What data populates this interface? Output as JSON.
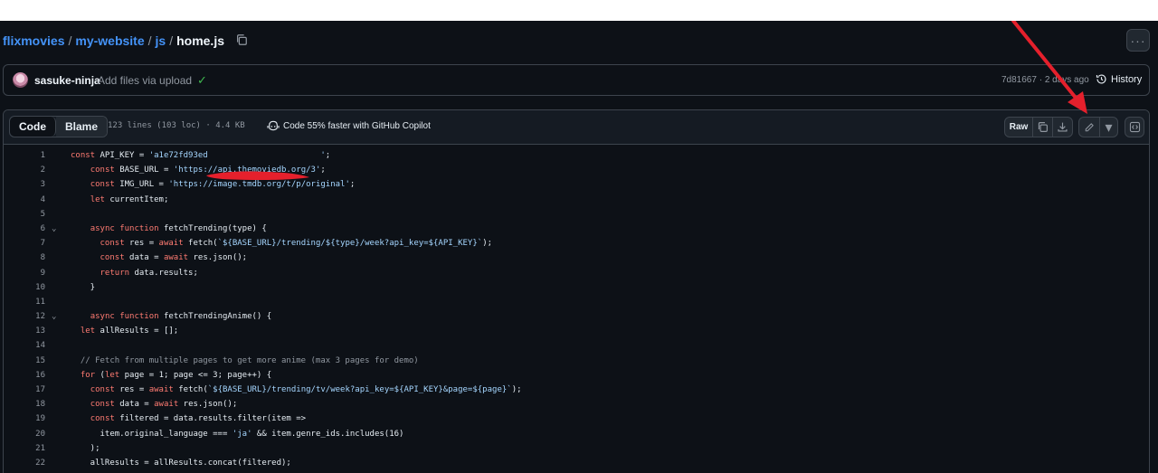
{
  "breadcrumb": {
    "owner": "flixmovies",
    "repo": "my-website",
    "dir": "js",
    "file": "home.js",
    "sep": "/"
  },
  "header": {
    "more_icon": "kebab-horizontal-icon",
    "more_label": "···"
  },
  "commit": {
    "author": "sasuke-ninja",
    "message": "Add files via upload",
    "status": "✓",
    "meta": "7d81667 · 2 days ago",
    "history_label": "History"
  },
  "file_header": {
    "tab_code": "Code",
    "tab_blame": "Blame",
    "info": "123 lines (103 loc) · 4.4 KB",
    "copilot": "Code 55% faster with GitHub Copilot",
    "raw_label": "Raw",
    "caret": "▾"
  },
  "colors": {
    "accent_link": "#4493f8",
    "success": "#3fb950",
    "keyword": "#ff7b72",
    "string": "#a5d6ff",
    "annotation_red": "#e5202c"
  },
  "code": [
    {
      "n": "1",
      "fold": "",
      "t": "const API_KEY = 'a1e72fd93ed                       ';"
    },
    {
      "n": "2",
      "fold": "",
      "t": "    const BASE_URL = 'https://api.themoviedb.org/3';"
    },
    {
      "n": "3",
      "fold": "",
      "t": "    const IMG_URL = 'https://image.tmdb.org/t/p/original';"
    },
    {
      "n": "4",
      "fold": "",
      "t": "    let currentItem;"
    },
    {
      "n": "5",
      "fold": "",
      "t": ""
    },
    {
      "n": "6",
      "fold": "⌄",
      "t": "    async function fetchTrending(type) {"
    },
    {
      "n": "7",
      "fold": "",
      "t": "      const res = await fetch(`${BASE_URL}/trending/${type}/week?api_key=${API_KEY}`);"
    },
    {
      "n": "8",
      "fold": "",
      "t": "      const data = await res.json();"
    },
    {
      "n": "9",
      "fold": "",
      "t": "      return data.results;"
    },
    {
      "n": "10",
      "fold": "",
      "t": "    }"
    },
    {
      "n": "11",
      "fold": "",
      "t": ""
    },
    {
      "n": "12",
      "fold": "⌄",
      "t": "    async function fetchTrendingAnime() {"
    },
    {
      "n": "13",
      "fold": "",
      "t": "  let allResults = [];"
    },
    {
      "n": "14",
      "fold": "",
      "t": ""
    },
    {
      "n": "15",
      "fold": "",
      "t": "  // Fetch from multiple pages to get more anime (max 3 pages for demo)"
    },
    {
      "n": "16",
      "fold": "",
      "t": "  for (let page = 1; page <= 3; page++) {"
    },
    {
      "n": "17",
      "fold": "",
      "t": "    const res = await fetch(`${BASE_URL}/trending/tv/week?api_key=${API_KEY}&page=${page}`);"
    },
    {
      "n": "18",
      "fold": "",
      "t": "    const data = await res.json();"
    },
    {
      "n": "19",
      "fold": "",
      "t": "    const filtered = data.results.filter(item =>"
    },
    {
      "n": "20",
      "fold": "",
      "t": "      item.original_language === 'ja' && item.genre_ids.includes(16)"
    },
    {
      "n": "21",
      "fold": "",
      "t": "    );"
    },
    {
      "n": "22",
      "fold": "",
      "t": "    allResults = allResults.concat(filtered);"
    }
  ]
}
